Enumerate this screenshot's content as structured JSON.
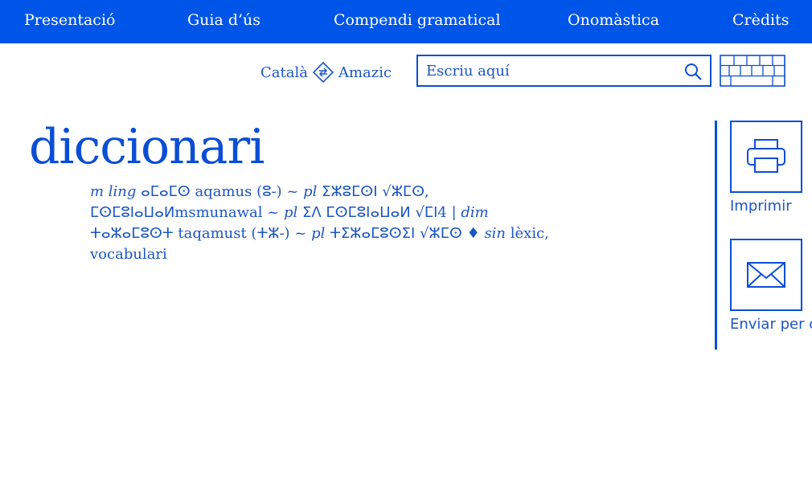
{
  "nav": {
    "items": [
      {
        "label": "Presentació"
      },
      {
        "label": "Guia d’ús"
      },
      {
        "label": "Compendi gramatical"
      },
      {
        "label": "Onomàstica"
      },
      {
        "label": "Crèdits"
      }
    ]
  },
  "lang": {
    "source": "Català",
    "target": "Amazic"
  },
  "search": {
    "placeholder": "Escriu aquí"
  },
  "title": "diccionari",
  "entry": {
    "line1": {
      "gram": "m ling",
      "tif": "ⴰⵎⴰⵎⵙ",
      "t1": " aqamus (ⵓ-) ~ ",
      "pl": "pl",
      "tif2": " ⵉⵣⵓⵎⵙⵏ √ⵣⵎⵙ,"
    },
    "line2": {
      "t1": "ⵎⵙⵎⵓⵏⴰⵡⴰⵍmsmunawal ~ ",
      "pl": "pl",
      "t2": " ⵉⴷ ⵎⵙⵎⵓⵏⴰⵡⴰⵍ √ⵎⵏ4 | ",
      "dim": "dim"
    },
    "line3": {
      "t1": "ⵜⴰⵣⴰⵎⵓⵙⵜ taqamust (ⵜⵣ-) ~ ",
      "pl": "pl",
      "t2": " ⵜⵉⵣⴰⵎⵓⵙⵉⵏ √ⵣⵎⵙ ♦ ",
      "sin": "sin",
      "t3": " lèxic,"
    },
    "line4": "vocabulari"
  },
  "side": {
    "print_label": "Imprimir",
    "email_label": "Enviar per c"
  },
  "colors": {
    "nav_bg": "#0055e9",
    "primary": "#0a4ed6"
  },
  "icons": [
    "swap-icon",
    "search-icon",
    "keyboard-icon",
    "printer-icon",
    "envelope-icon"
  ]
}
